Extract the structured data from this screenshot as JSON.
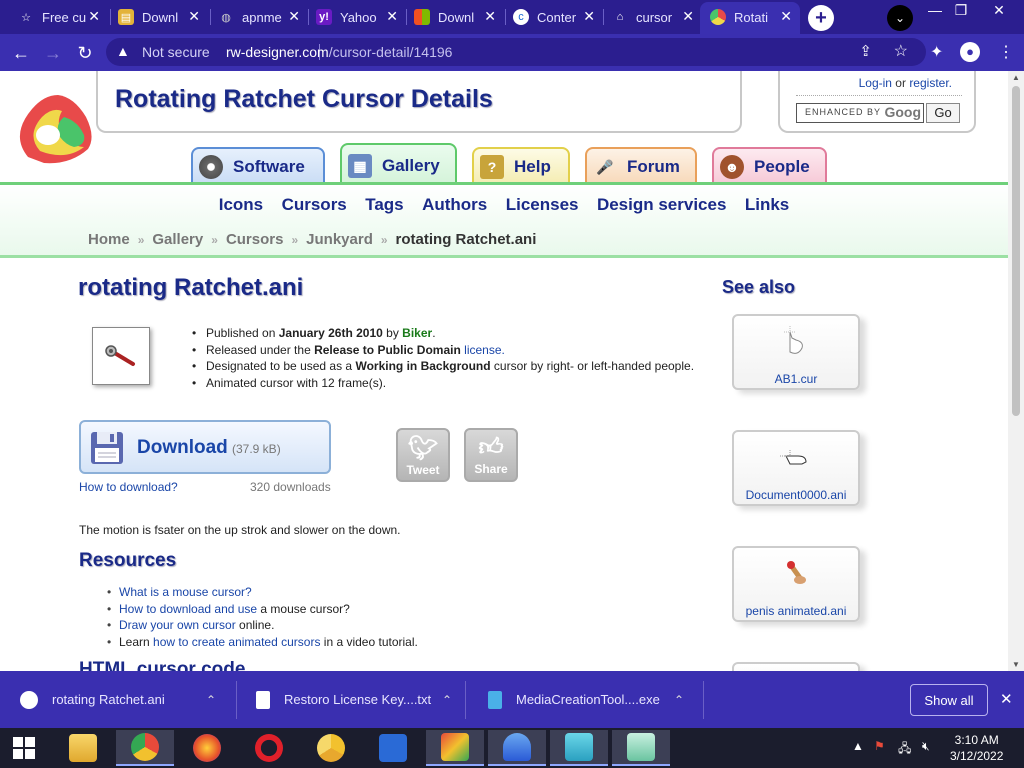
{
  "browser": {
    "tabs": [
      {
        "title": "Free cu",
        "icon": "star-icon"
      },
      {
        "title": "Downl",
        "icon": "document-icon"
      },
      {
        "title": "apnme",
        "icon": "globe-icon"
      },
      {
        "title": "Yahoo",
        "icon": "yahoo-icon"
      },
      {
        "title": "Downl",
        "icon": "windows-icon"
      },
      {
        "title": "Conter",
        "icon": "cloud-icon"
      },
      {
        "title": "cursor",
        "icon": "bank-icon"
      },
      {
        "title": "Rotati",
        "icon": "rw-designer-icon"
      }
    ],
    "not_secure": "Not secure",
    "url_domain": "rw-designer.com",
    "url_path": "/cursor-detail/14196"
  },
  "header": {
    "title": "Rotating Ratchet Cursor Details",
    "login": "Log-in",
    "or": "or",
    "register": "register.",
    "search_label": "ENHANCED BY",
    "search_brand": "Goog",
    "go": "Go"
  },
  "nav_tabs": [
    {
      "label": "Software",
      "icon": "disc-icon",
      "color": "#5b8ed6"
    },
    {
      "label": "Gallery",
      "icon": "easel-icon",
      "color": "#5ec96a"
    },
    {
      "label": "Help",
      "icon": "help-icon",
      "color": "#e2d04a"
    },
    {
      "label": "Forum",
      "icon": "microphone-icon",
      "color": "#e9a05a"
    },
    {
      "label": "People",
      "icon": "person-icon",
      "color": "#e07a9a"
    }
  ],
  "menu": [
    "Icons",
    "Cursors",
    "Tags",
    "Authors",
    "Licenses",
    "Design services",
    "Links"
  ],
  "breadcrumb": [
    "Home",
    "Gallery",
    "Cursors",
    "Junkyard",
    "rotating Ratchet.ani"
  ],
  "detail": {
    "title": "rotating Ratchet.ani",
    "published_prefix": "Published on",
    "published_date": "January 26th 2010",
    "by": "by",
    "author": "Biker",
    "released_prefix": "Released under the",
    "license_name": "Release to Public Domain",
    "license_link": "license.",
    "designated_prefix": "Designated to be used as a",
    "role": "Working in Background",
    "designated_suffix": "cursor by right- or left-handed people.",
    "frames": "Animated cursor with 12 frame(s).",
    "download_label": "Download",
    "download_size": "(37.9 kB)",
    "how_to_download": "How to download?",
    "downloads": "320 downloads",
    "tweet": "Tweet",
    "share": "Share",
    "description": "The motion is fsater on the up strok and slower on the down."
  },
  "resources": {
    "heading": "Resources",
    "items": [
      {
        "link": "What is a mouse cursor?",
        "text": ""
      },
      {
        "link": "How to download and use",
        "text": " a mouse cursor?"
      },
      {
        "link": "Draw your own cursor",
        "text": " online."
      },
      {
        "pre": "Learn ",
        "link": "how to create animated cursors",
        "text": " in a video tutorial."
      }
    ],
    "next_heading": "HTML cursor code"
  },
  "see_also": {
    "heading": "See also",
    "items": [
      "AB1.cur",
      "Document0000.ani",
      "penis animated.ani"
    ]
  },
  "downloads_shelf": {
    "items": [
      "rotating Ratchet.ani",
      "Restoro License Key....txt",
      "MediaCreationTool....exe"
    ],
    "show_all": "Show all"
  },
  "taskbar": {
    "time": "3:10 AM",
    "date": "3/12/2022"
  }
}
